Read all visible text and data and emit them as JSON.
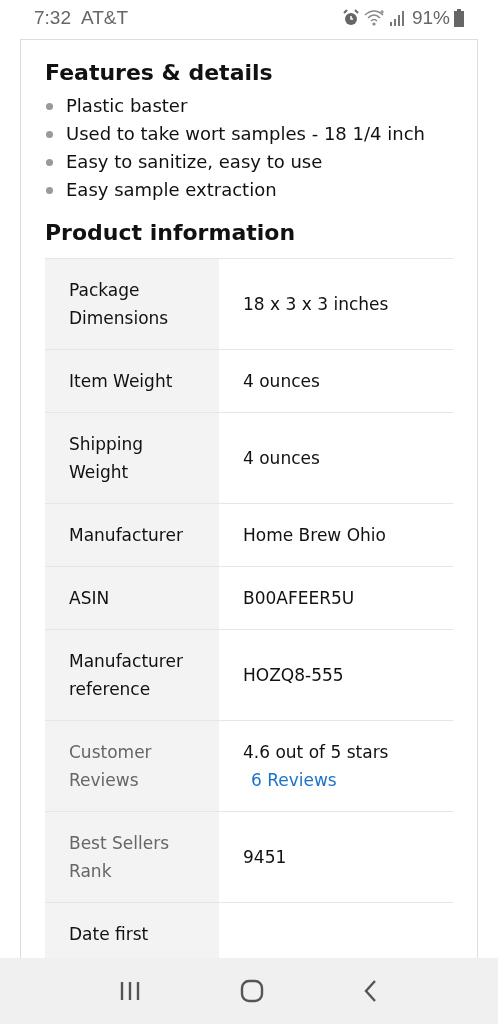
{
  "status_bar": {
    "time": "7:32",
    "carrier": "AT&T",
    "battery": "91%"
  },
  "features": {
    "title": "Features & details",
    "items": [
      "Plastic baster",
      "Used to take wort samples - 18 1/4 inch",
      "Easy to sanitize, easy to use",
      "Easy sample extraction"
    ]
  },
  "product_information": {
    "title": "Product information",
    "rows": [
      {
        "label": "Package Dimensions",
        "value": "18 x 3 x 3 inches",
        "dimmed": false
      },
      {
        "label": "Item Weight",
        "value": "4 ounces",
        "dimmed": false
      },
      {
        "label": "Shipping Weight",
        "value": "4 ounces",
        "dimmed": false
      },
      {
        "label": "Manufacturer",
        "value": "Home Brew Ohio",
        "dimmed": false
      },
      {
        "label": "ASIN",
        "value": "B00AFEER5U",
        "dimmed": false
      },
      {
        "label": "Manufacturer reference",
        "value": "HOZQ8-555",
        "dimmed": false
      },
      {
        "label": "Customer Reviews",
        "value": "4.6 out of 5 stars",
        "link": "6 Reviews",
        "dimmed": true
      },
      {
        "label": "Best Sellers Rank",
        "value": "9451",
        "dimmed": true
      },
      {
        "label": "Date first",
        "dimmed": false
      }
    ]
  }
}
